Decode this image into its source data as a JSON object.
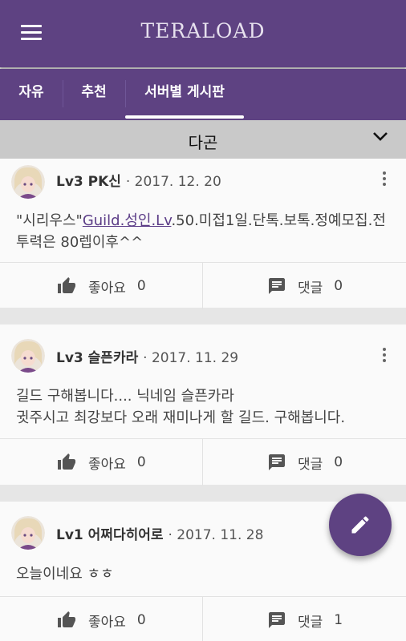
{
  "app": {
    "title": "TERALOAD"
  },
  "tabs": [
    {
      "label": "자유"
    },
    {
      "label": "추천"
    },
    {
      "label": "서버별 게시판",
      "active": true
    }
  ],
  "filter": {
    "selected": "다곤"
  },
  "posts": [
    {
      "author": "Lv3 PK신",
      "date": "2017. 12. 20",
      "body_prefix": "\"시리우스\"",
      "body_link": "Guild.성인.Lv",
      "body_suffix": ".50.미접1일.단톡.보톡.정예모집.전투력은 80렙이후^^",
      "like_label": "좋아요",
      "like_count": "0",
      "comment_label": "댓글",
      "comment_count": "0"
    },
    {
      "author": "Lv3 슬픈카라",
      "date": "2017. 11. 29",
      "body_line1": "길드 구해봅니다.... 닉네임 슬픈카라",
      "body_line2": "귓주시고 최강보다 오래 재미나게 할 길드. 구해봅니다.",
      "like_label": "좋아요",
      "like_count": "0",
      "comment_label": "댓글",
      "comment_count": "0"
    },
    {
      "author": "Lv1 어쩌다히어로",
      "date": "2017. 11. 28",
      "body_line1": "오늘이네요 ㅎㅎ",
      "like_label": "좋아요",
      "like_count": "0",
      "comment_label": "댓글",
      "comment_count": "1"
    }
  ],
  "colors": {
    "primary": "#5e4282",
    "link": "#5b3c87",
    "filter_bg": "#c9c9c9"
  },
  "icons": [
    "menu-icon",
    "chevron-down-icon",
    "more-vert-icon",
    "thumb-up-icon",
    "comment-icon",
    "pencil-icon"
  ]
}
